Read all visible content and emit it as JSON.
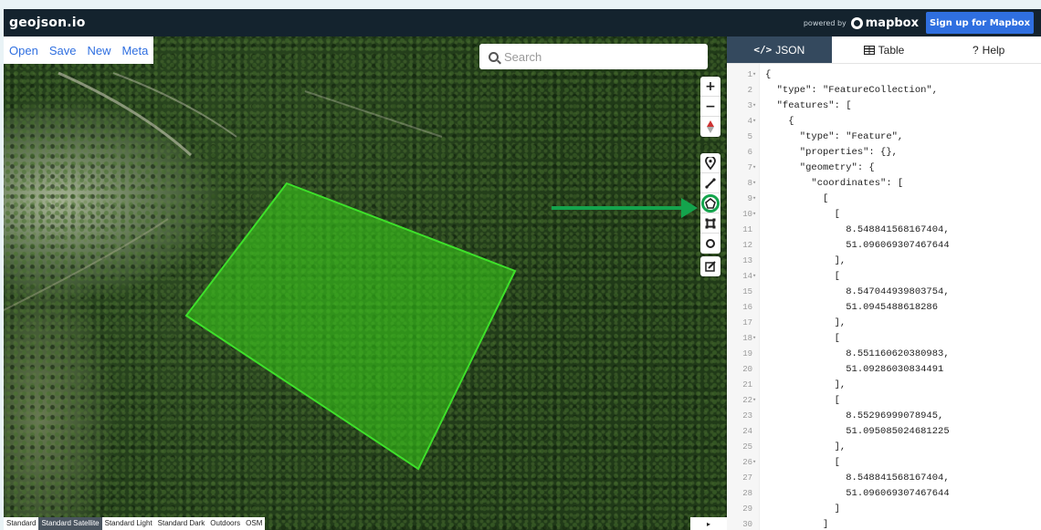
{
  "app": {
    "brand": "geojson.io",
    "powered_by": "powered by",
    "mapbox": "mapbox",
    "signup": "Sign up for Mapbox"
  },
  "map_menu": [
    "Open",
    "Save",
    "New",
    "Meta"
  ],
  "search": {
    "placeholder": "Search"
  },
  "controls": {
    "zoom_in": "+",
    "zoom_out": "−",
    "compass": "↑",
    "tools": [
      "marker-icon",
      "line-icon",
      "polygon-icon",
      "rectangle-icon",
      "circle-icon",
      "edit-icon"
    ],
    "active_tool": "polygon-icon"
  },
  "map_styles": [
    "Standard",
    "Standard Satellite",
    "Standard Light",
    "Standard Dark",
    "Outdoors",
    "OSM"
  ],
  "selected_style": "Standard Satellite",
  "colors": {
    "polygon_fill": "#39d419",
    "polygon_stroke": "#3ee02a",
    "arrow": "#14a44d",
    "accent": "#2f6fe0"
  },
  "tabs": [
    {
      "label": "JSON",
      "icon": "code-icon",
      "active": true
    },
    {
      "label": "Table",
      "icon": "table-icon",
      "active": false
    },
    {
      "label": "Help",
      "icon": "help-icon",
      "active": false
    }
  ],
  "code_lines": [
    {
      "n": "1",
      "fold": true,
      "text": "{"
    },
    {
      "n": "2",
      "fold": false,
      "text": "  \"type\": \"FeatureCollection\","
    },
    {
      "n": "3",
      "fold": true,
      "text": "  \"features\": ["
    },
    {
      "n": "4",
      "fold": true,
      "text": "    {"
    },
    {
      "n": "5",
      "fold": false,
      "text": "      \"type\": \"Feature\","
    },
    {
      "n": "6",
      "fold": false,
      "text": "      \"properties\": {},"
    },
    {
      "n": "7",
      "fold": true,
      "text": "      \"geometry\": {"
    },
    {
      "n": "8",
      "fold": true,
      "text": "        \"coordinates\": ["
    },
    {
      "n": "9",
      "fold": true,
      "text": "          ["
    },
    {
      "n": "10",
      "fold": true,
      "text": "            ["
    },
    {
      "n": "11",
      "fold": false,
      "text": "              8.548841568167404,"
    },
    {
      "n": "12",
      "fold": false,
      "text": "              51.096069307467644"
    },
    {
      "n": "13",
      "fold": false,
      "text": "            ],"
    },
    {
      "n": "14",
      "fold": true,
      "text": "            ["
    },
    {
      "n": "15",
      "fold": false,
      "text": "              8.547044939803754,"
    },
    {
      "n": "16",
      "fold": false,
      "text": "              51.0945488618286"
    },
    {
      "n": "17",
      "fold": false,
      "text": "            ],"
    },
    {
      "n": "18",
      "fold": true,
      "text": "            ["
    },
    {
      "n": "19",
      "fold": false,
      "text": "              8.551160620380983,"
    },
    {
      "n": "20",
      "fold": false,
      "text": "              51.09286030834491"
    },
    {
      "n": "21",
      "fold": false,
      "text": "            ],"
    },
    {
      "n": "22",
      "fold": true,
      "text": "            ["
    },
    {
      "n": "23",
      "fold": false,
      "text": "              8.55296999078945,"
    },
    {
      "n": "24",
      "fold": false,
      "text": "              51.095085024681225"
    },
    {
      "n": "25",
      "fold": false,
      "text": "            ],"
    },
    {
      "n": "26",
      "fold": true,
      "text": "            ["
    },
    {
      "n": "27",
      "fold": false,
      "text": "              8.548841568167404,"
    },
    {
      "n": "28",
      "fold": false,
      "text": "              51.096069307467644"
    },
    {
      "n": "29",
      "fold": false,
      "text": "            ]"
    },
    {
      "n": "30",
      "fold": false,
      "text": "          ]"
    }
  ]
}
